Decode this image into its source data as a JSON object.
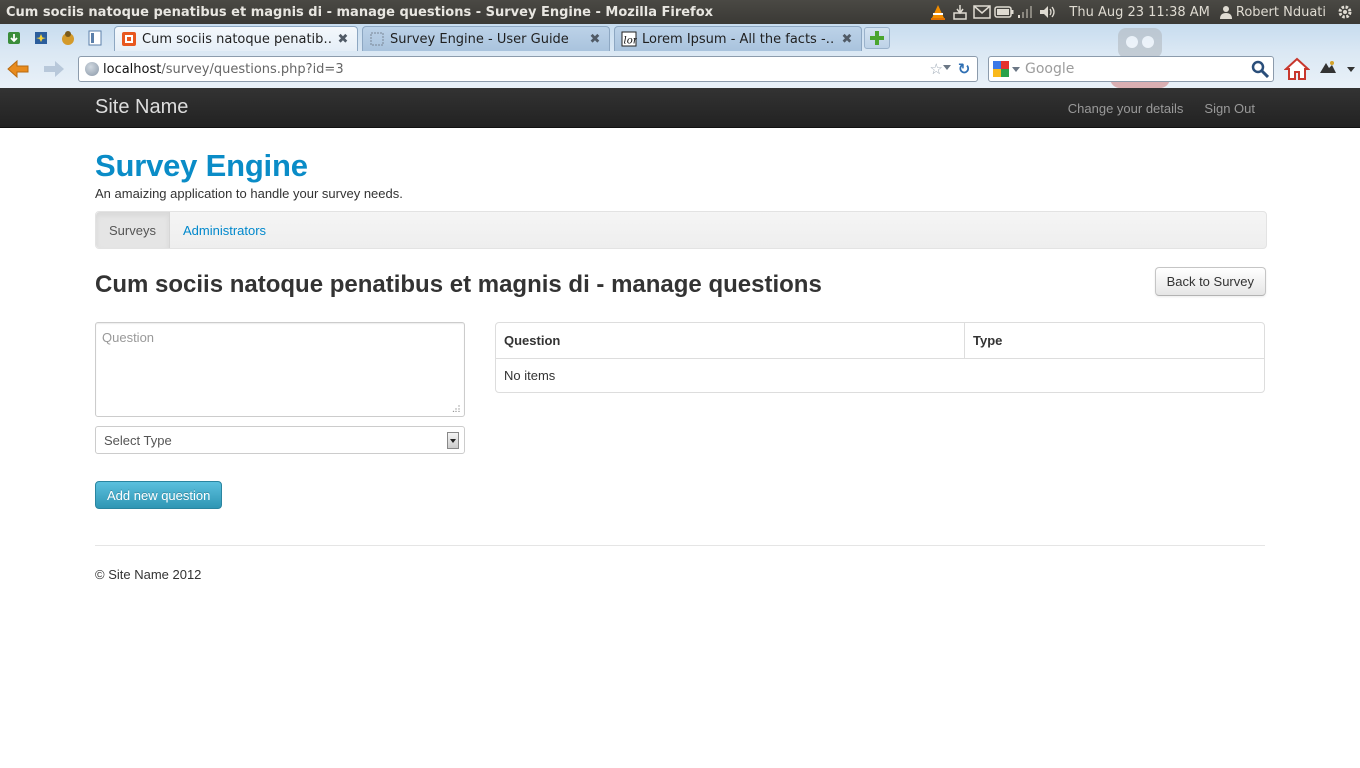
{
  "os_panel": {
    "window_title": "Cum sociis natoque penatibus et magnis di - manage questions - Survey Engine - Mozilla Firefox",
    "clock": "Thu Aug 23 11:38 AM",
    "user": "Robert Nduati",
    "indicators": [
      "vlc-icon",
      "update-icon",
      "mail-icon",
      "battery-icon",
      "signal-icon",
      "volume-icon"
    ]
  },
  "browser": {
    "tabs": [
      {
        "label": "Cum sociis natoque penatib…",
        "active": true
      },
      {
        "label": "Survey Engine - User Guide",
        "active": false
      },
      {
        "label": "Lorem Ipsum - All the facts -…",
        "active": false
      }
    ],
    "url": {
      "host": "localhost",
      "path": "/survey/questions.php?id=3"
    },
    "search_placeholder": "Google"
  },
  "navbar": {
    "brand": "Site Name",
    "links": [
      "Change your details",
      "Sign Out"
    ]
  },
  "header": {
    "title": "Survey Engine",
    "tagline": "An amaizing application to handle your survey needs."
  },
  "subnav": {
    "items": [
      {
        "label": "Surveys",
        "active": true
      },
      {
        "label": "Administrators",
        "active": false
      }
    ]
  },
  "main": {
    "heading": "Cum sociis natoque penatibus et magnis di - manage questions",
    "back_button": "Back to Survey",
    "question_placeholder": "Question",
    "type_select_value": "Select Type",
    "add_button": "Add new question",
    "table": {
      "columns": [
        "Question",
        "Type"
      ],
      "empty_text": "No items"
    }
  },
  "footer": {
    "text": "© Site Name 2012"
  },
  "colors": {
    "link": "#0088cc",
    "title": "#0a8cc7",
    "navbar_bg": "#222222",
    "info_button": "#2f96b4"
  }
}
